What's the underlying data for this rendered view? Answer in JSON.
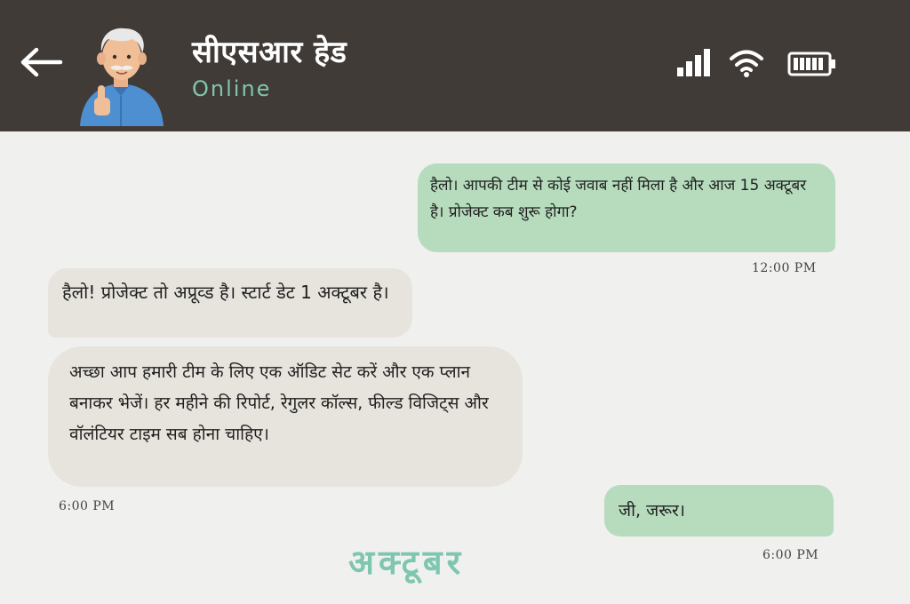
{
  "header": {
    "contact_name": "सीएसआर हेड",
    "status": "Online",
    "icons": {
      "back": "arrow-left-icon",
      "avatar": "avatar-elderly-man-thumbs-up",
      "signal": "signal-strength-icon",
      "wifi": "wifi-icon",
      "battery": "battery-full-icon"
    },
    "colors": {
      "header_bg": "#413b37",
      "status_color": "#7fc6b0"
    }
  },
  "messages": [
    {
      "direction": "outgoing",
      "text": "हैलो। आपकी टीम से कोई जवाब नहीं मिला है और आज 15 अक्टूबर है। प्रोजेक्ट कब शुरू होगा?",
      "time": "12:00 PM"
    },
    {
      "direction": "incoming",
      "text": "हैलो! प्रोजेक्ट तो अप्रूव्ड है। स्टार्ट डेट 1 अक्टूबर है।",
      "time": ""
    },
    {
      "direction": "incoming",
      "text": "अच्छा आप हमारी टीम के लिए एक ऑडिट सेट करें और एक प्लान बनाकर भेजें। हर महीने की रिपोर्ट, रेगुलर कॉल्स, फील्ड विजिट्स और वॉलंटियर टाइम सब होना चाहिए।",
      "time": "6:00 PM"
    },
    {
      "direction": "outgoing",
      "text": "जी, जरूर।",
      "time": "6:00 PM"
    }
  ],
  "date_divider": "अक्टूबर",
  "colors": {
    "chat_bg": "#f0f0ef",
    "outgoing_bubble": "#b6dcbd",
    "incoming_bubble": "#e7e4dd"
  }
}
